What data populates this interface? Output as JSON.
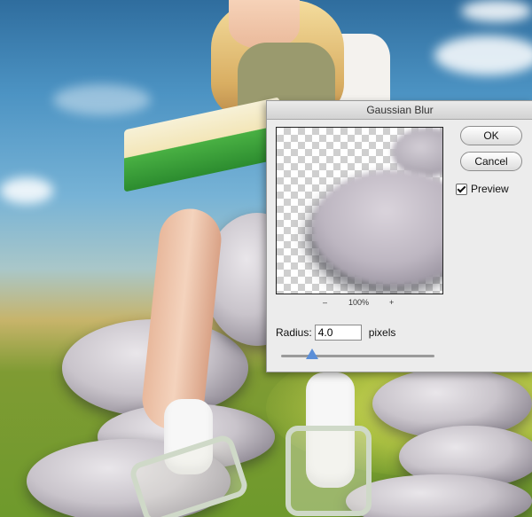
{
  "dialog": {
    "title": "Gaussian Blur",
    "ok_label": "OK",
    "cancel_label": "Cancel",
    "preview_label": "Preview",
    "preview_checked": true,
    "zoom_minus": "–",
    "zoom_level": "100%",
    "zoom_plus": "+",
    "radius_label": "Radius:",
    "radius_value": "4.0",
    "radius_unit": "pixels",
    "slider_value_fraction": 0.2
  }
}
